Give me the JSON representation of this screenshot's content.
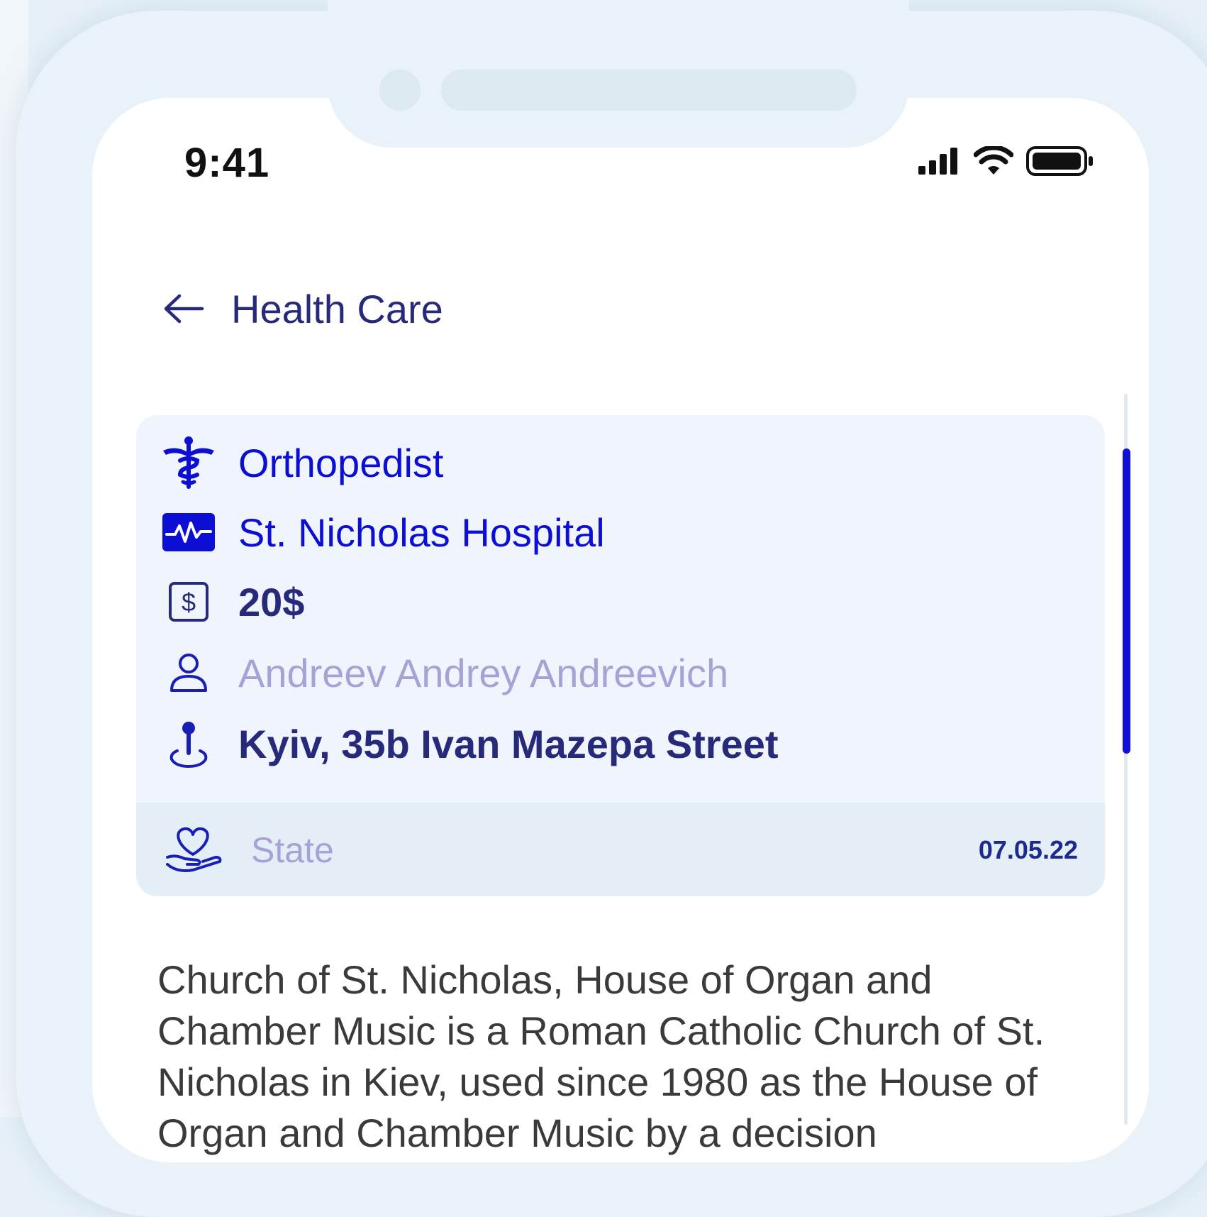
{
  "status_bar": {
    "time": "9:41"
  },
  "header": {
    "title": "Health Care"
  },
  "card": {
    "specialty": "Orthopedist",
    "hospital": "St. Nicholas Hospital",
    "price": "20$",
    "doctor": "Andreev Andrey Andreevich",
    "address": "Kyiv, 35b Ivan Mazepa Street",
    "footer": {
      "label": "State",
      "date": "07.05.22"
    }
  },
  "description": {
    "text": "Church of St. Nicholas, House of Organ and Chamber Music is a Roman Catholic Church of St. Nicholas in Kiev, used since 1980 as the House of Organ and Chamber Music by a decision"
  },
  "icons": {
    "back": "arrow-left-icon",
    "specialty": "caduceus-icon",
    "hospital": "heartbeat-monitor-icon",
    "price": "dollar-icon",
    "doctor": "user-icon",
    "address": "location-pin-icon",
    "state": "heart-hand-icon"
  },
  "colors": {
    "accent": "#0d0ed3",
    "dark_text": "#262a79",
    "muted_text": "#a7a2d6",
    "card_bg": "#f0f5fd",
    "footer_bg": "#e3eef7"
  }
}
